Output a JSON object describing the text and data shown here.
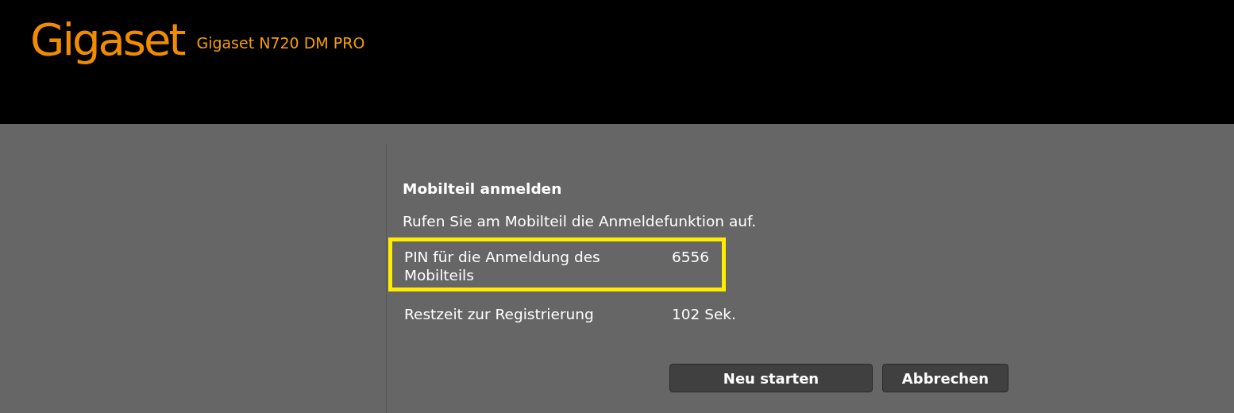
{
  "header": {
    "logo": "Gigaset",
    "model": "Gigaset N720 DM PRO"
  },
  "dialog": {
    "title": "Mobilteil anmelden",
    "instruction": "Rufen Sie am Mobilteil die Anmeldefunktion auf.",
    "rows": [
      {
        "label": "PIN für die Anmeldung des Mobilteils",
        "value": "6556",
        "highlighted": true
      },
      {
        "label": "Restzeit zur Registrierung",
        "value": "102 Sek.",
        "highlighted": false
      }
    ],
    "buttons": [
      {
        "label": "Neu starten",
        "wide": true
      },
      {
        "label": "Abbrechen",
        "wide": false
      }
    ]
  }
}
